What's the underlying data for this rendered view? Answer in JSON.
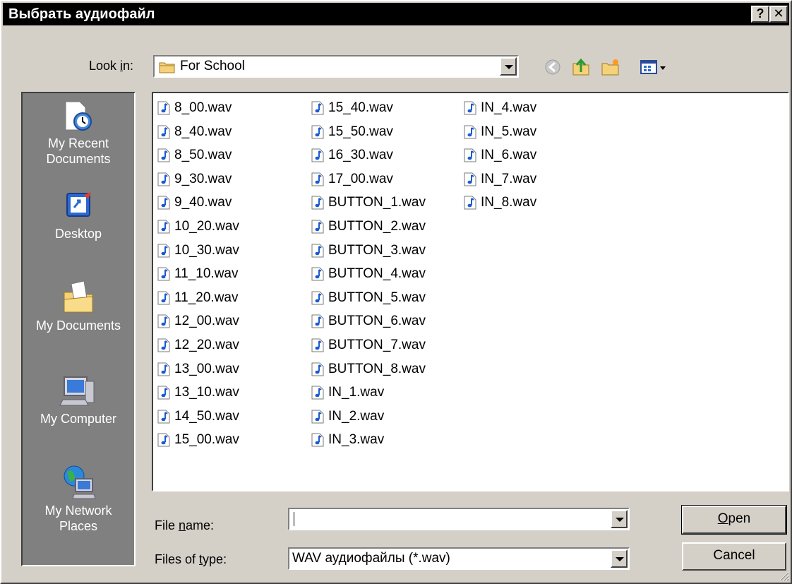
{
  "window": {
    "title": "Выбрать аудиофайл",
    "help_glyph": "?",
    "close_glyph": "✕"
  },
  "look_in": {
    "label_before": "Look ",
    "label_key": "i",
    "label_after": "n:",
    "value": "For School"
  },
  "toolbar": {
    "icons": [
      "back-icon",
      "up-folder-icon",
      "new-folder-icon",
      "view-menu-icon"
    ]
  },
  "places": [
    {
      "label_line1": "My Recent",
      "label_line2": "Documents",
      "icon": "recent-documents-icon"
    },
    {
      "label_line1": "Desktop",
      "label_line2": "",
      "icon": "desktop-icon"
    },
    {
      "label_line1": "My Documents",
      "label_line2": "",
      "icon": "my-documents-icon"
    },
    {
      "label_line1": "My Computer",
      "label_line2": "",
      "icon": "my-computer-icon"
    },
    {
      "label_line1": "My Network",
      "label_line2": "Places",
      "icon": "network-places-icon"
    }
  ],
  "files": [
    "8_00.wav",
    "8_40.wav",
    "8_50.wav",
    "9_30.wav",
    "9_40.wav",
    "10_20.wav",
    "10_30.wav",
    "11_10.wav",
    "11_20.wav",
    "12_00.wav",
    "12_20.wav",
    "13_00.wav",
    "13_10.wav",
    "14_50.wav",
    "15_00.wav",
    "15_40.wav",
    "15_50.wav",
    "16_30.wav",
    "17_00.wav",
    "BUTTON_1.wav",
    "BUTTON_2.wav",
    "BUTTON_3.wav",
    "BUTTON_4.wav",
    "BUTTON_5.wav",
    "BUTTON_6.wav",
    "BUTTON_7.wav",
    "BUTTON_8.wav",
    "IN_1.wav",
    "IN_2.wav",
    "IN_3.wav",
    "IN_4.wav",
    "IN_5.wav",
    "IN_6.wav",
    "IN_7.wav",
    "IN_8.wav"
  ],
  "file_name": {
    "label_before": "File ",
    "label_key": "n",
    "label_after": "ame:",
    "value": ""
  },
  "file_type": {
    "label_before": "Files of ",
    "label_key": "t",
    "label_after": "ype:",
    "value": "WAV аудиофайлы (*.wav)"
  },
  "buttons": {
    "open_key": "O",
    "open_rest": "pen",
    "cancel": "Cancel"
  },
  "colors": {
    "title_bar": "#000000",
    "dialog_face": "#d4d0c8",
    "places_bar": "#808080",
    "list_bg": "#ffffff"
  }
}
